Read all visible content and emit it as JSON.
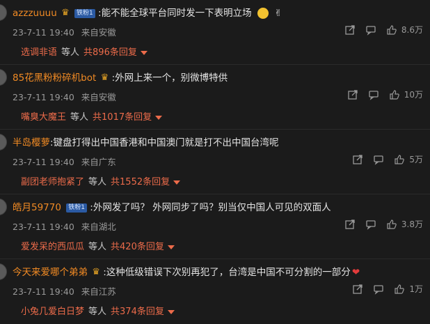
{
  "comments": [
    {
      "user": "azzzuuuu",
      "badge": "铁粉1",
      "has_crown": true,
      "text": ":能不能全球平台同时发一下表明立场",
      "trail": "laugh-emoji",
      "time": "23-7-11 19:40",
      "location": "来自安徽",
      "likes": "8.6万",
      "reply_name": "选调非语",
      "reply_mid": "等人",
      "reply_count": "共896条回复"
    },
    {
      "user": "85花黑粉粉碎机bot",
      "badge": "",
      "has_crown": true,
      "text": ":外网上来一个，别微博特供",
      "trail": "",
      "time": "23-7-11 19:40",
      "location": "来自安徽",
      "likes": "10万",
      "reply_name": "嘴臭大魔王",
      "reply_mid": "等人",
      "reply_count": "共1017条回复"
    },
    {
      "user": "半岛樱萝",
      "badge": "",
      "has_crown": false,
      "text": ":键盘打得出中国香港和中国澳门就是打不出中国台湾呢",
      "trail": "",
      "time": "23-7-11 19:40",
      "location": "来自广东",
      "likes": "5万",
      "reply_name": "副团老师抱紧了",
      "reply_mid": "等人",
      "reply_count": "共1552条回复"
    },
    {
      "user": "皓月59770",
      "badge": "铁粉1",
      "has_crown": false,
      "text": ":外网发了吗？ 外网同步了吗？别当仅中国人可见的双面人",
      "trail": "",
      "time": "23-7-11 19:40",
      "location": "来自湖北",
      "likes": "3.8万",
      "reply_name": "爱发呆的西瓜瓜",
      "reply_mid": "等人",
      "reply_count": "共420条回复"
    },
    {
      "user": "今天来爱哪个弟弟",
      "badge": "",
      "has_crown": true,
      "text": ":这种低级错误下次别再犯了，台湾是中国不可分割的一部分",
      "trail": "heart",
      "time": "23-7-11 19:40",
      "location": "来自江苏",
      "likes": "1万",
      "reply_name": "小兔几爱白日梦",
      "reply_mid": "等人",
      "reply_count": "共374条回复"
    }
  ]
}
